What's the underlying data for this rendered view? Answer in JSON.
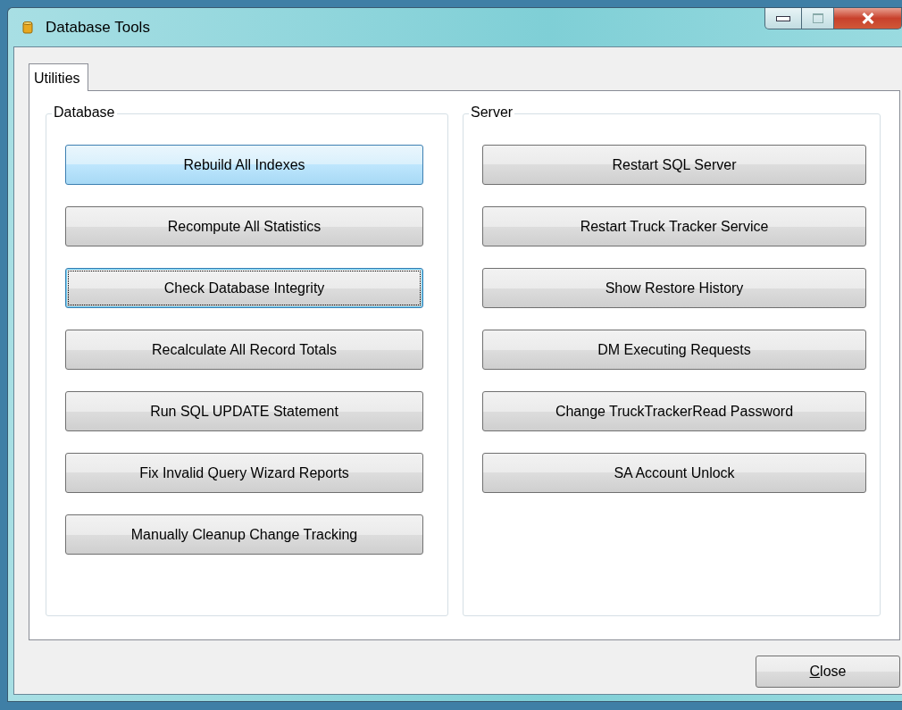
{
  "window": {
    "title": "Database Tools"
  },
  "tabs": [
    {
      "label": "Utilities",
      "selected": true
    }
  ],
  "groups": [
    {
      "title": "Database",
      "buttons": [
        {
          "label": "Rebuild All Indexes",
          "hovered": true,
          "focused": false
        },
        {
          "label": "Recompute All Statistics",
          "hovered": false,
          "focused": false
        },
        {
          "label": "Check Database Integrity",
          "hovered": false,
          "focused": true
        },
        {
          "label": "Recalculate All Record Totals",
          "hovered": false,
          "focused": false
        },
        {
          "label": "Run SQL UPDATE Statement",
          "hovered": false,
          "focused": false
        },
        {
          "label": "Fix Invalid Query Wizard Reports",
          "hovered": false,
          "focused": false
        },
        {
          "label": "Manually Cleanup Change Tracking",
          "hovered": false,
          "focused": false
        }
      ]
    },
    {
      "title": "Server",
      "buttons": [
        {
          "label": "Restart SQL Server",
          "hovered": false,
          "focused": false
        },
        {
          "label": "Restart Truck Tracker Service",
          "hovered": false,
          "focused": false
        },
        {
          "label": "Show Restore History",
          "hovered": false,
          "focused": false
        },
        {
          "label": "DM Executing Requests",
          "hovered": false,
          "focused": false
        },
        {
          "label": "Change TruckTrackerRead Password",
          "hovered": false,
          "focused": false
        },
        {
          "label": "SA Account Unlock",
          "hovered": false,
          "focused": false
        }
      ]
    }
  ],
  "close_button": {
    "label": "Close",
    "access_key_underlined": true
  }
}
